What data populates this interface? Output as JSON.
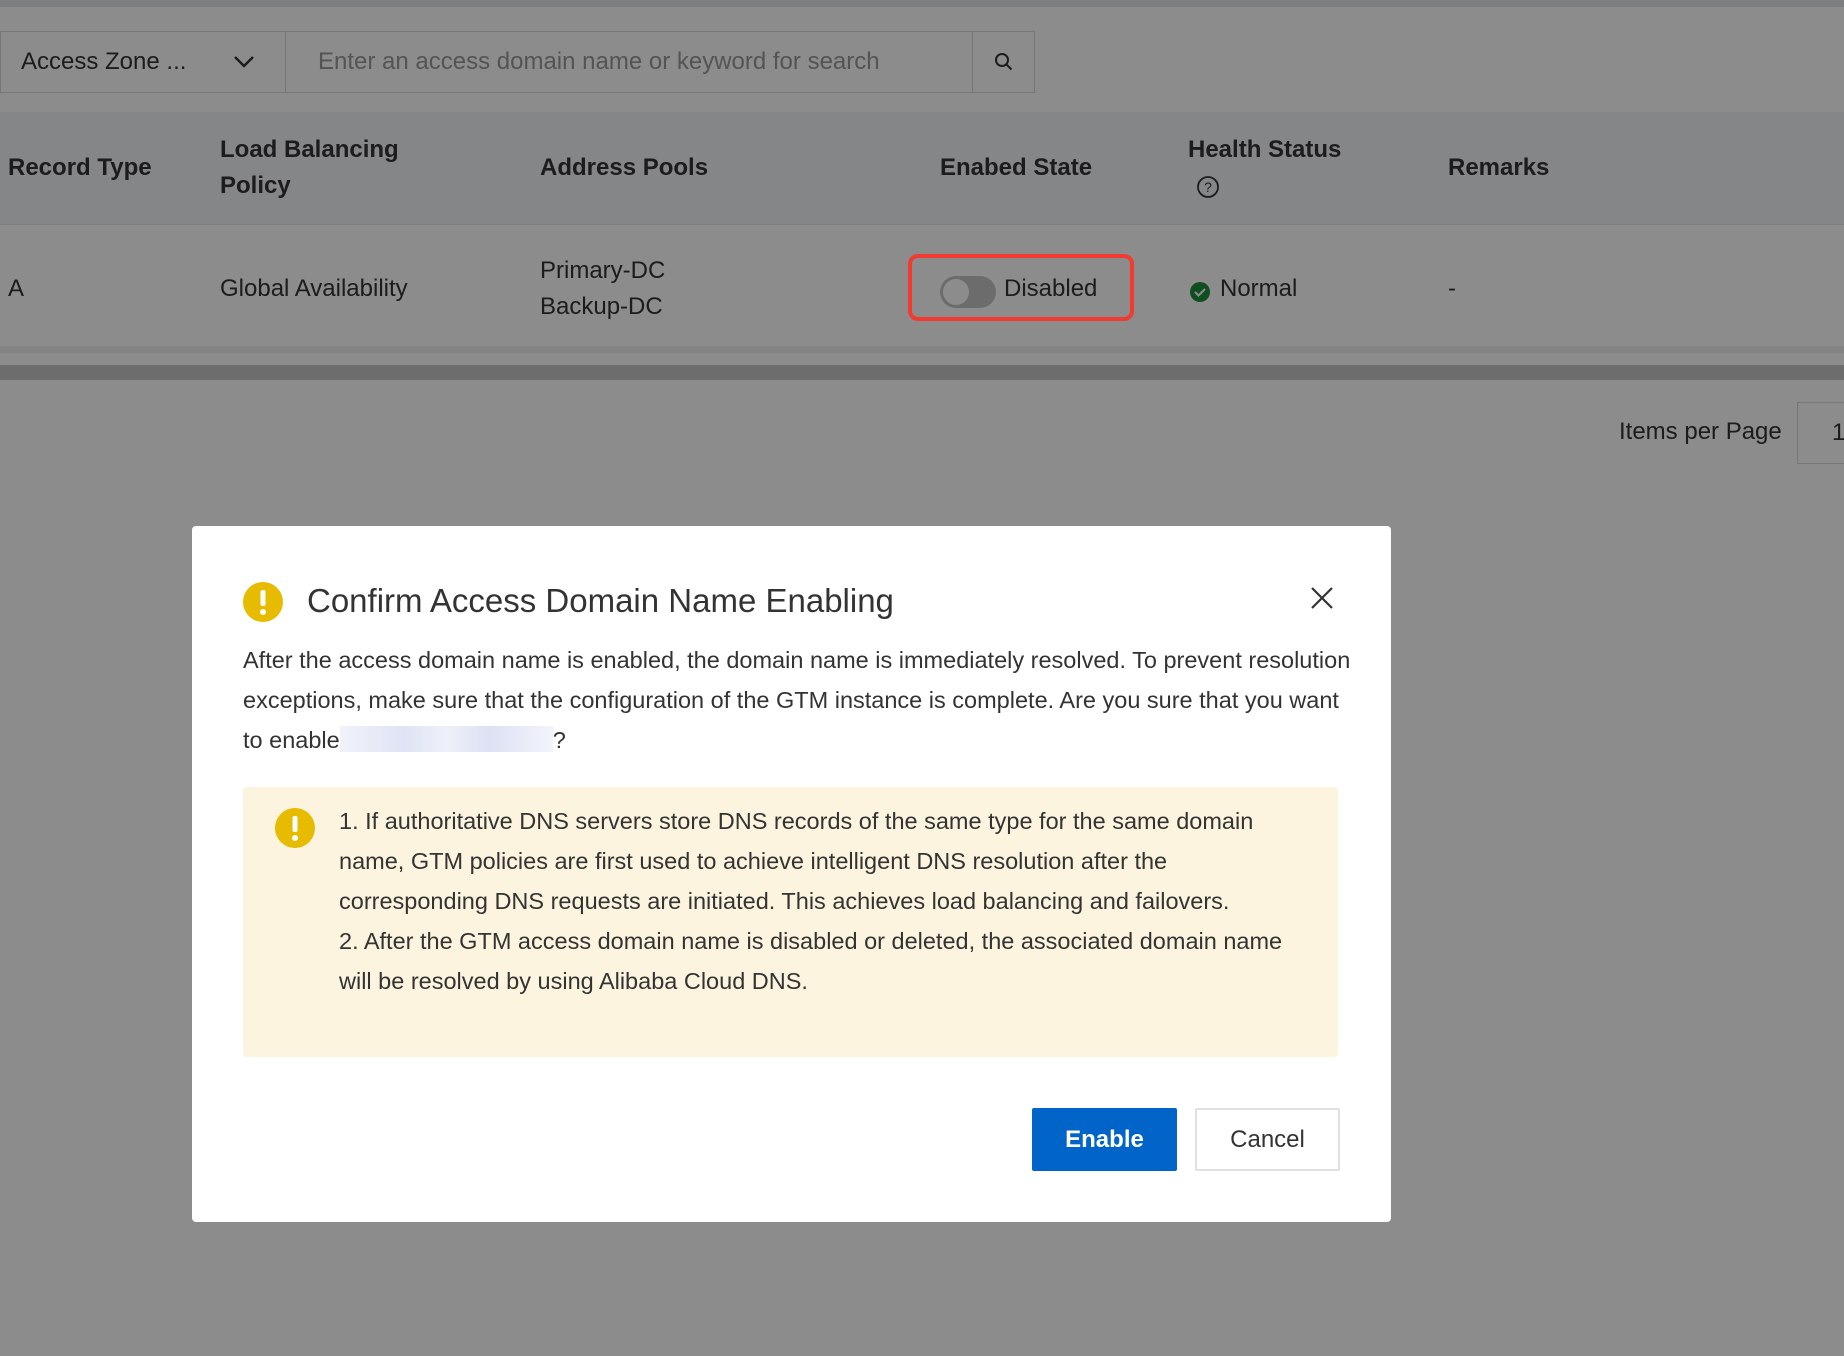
{
  "toolbar": {
    "zone_select": "Access Zone ...",
    "search_placeholder": "Enter an access domain name or keyword for search"
  },
  "table": {
    "headers": [
      "Record Type",
      "Load Balancing",
      "Policy",
      "Address Pools",
      "Enabed State",
      "Health Status",
      "Remarks"
    ],
    "row": {
      "record_type": "A",
      "policy": "Global Availability",
      "pool1": "Primary-DC",
      "pool2": "Backup-DC",
      "state": "Disabled",
      "health": "Normal",
      "remarks": "-"
    }
  },
  "pagination": {
    "items_per_page_label": "Items per Page",
    "items_per_page_value": "1"
  },
  "dialog": {
    "title": "Confirm Access Domain Name Enabling",
    "body": "After the access domain name is enabled, the domain name is immediately resolved. To prevent resolution exceptions, make sure that the configuration of the GTM instance is complete. Are you sure that you want to enable",
    "body_end": "?",
    "notes": [
      "1. If authoritative DNS servers store DNS records of the same type for the same domain name, GTM policies are first used to achieve intelligent DNS resolution after the corresponding DNS requests are initiated. This achieves load balancing and failovers.",
      "2. After the GTM access domain name is disabled or deleted, the associated domain name will be resolved by using Alibaba Cloud DNS."
    ],
    "enable_label": "Enable",
    "cancel_label": "Cancel"
  },
  "colors": {
    "primary": "#0064c8",
    "warning": "#e6bb00",
    "success": "#1e8e3e",
    "highlight": "#f23a30"
  }
}
